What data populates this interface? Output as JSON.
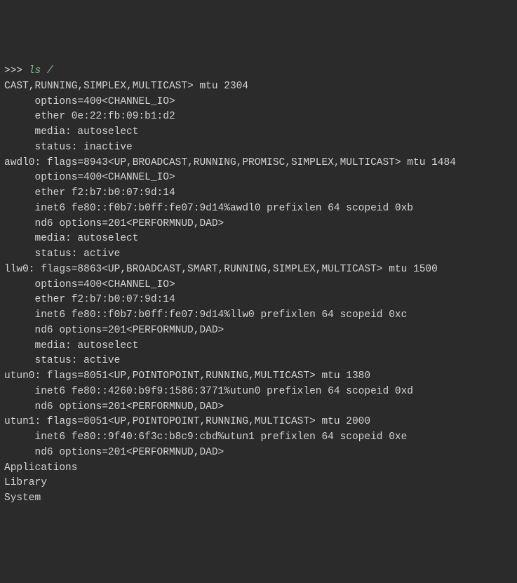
{
  "prompt": ">>> ",
  "command": "ls /",
  "lines": [
    "CAST,RUNNING,SIMPLEX,MULTICAST> mtu 2304",
    "     options=400<CHANNEL_IO>",
    "     ether 0e:22:fb:09:b1:d2",
    "     media: autoselect",
    "     status: inactive",
    "awdl0: flags=8943<UP,BROADCAST,RUNNING,PROMISC,SIMPLEX,MULTICAST> mtu 1484",
    "     options=400<CHANNEL_IO>",
    "     ether f2:b7:b0:07:9d:14",
    "     inet6 fe80::f0b7:b0ff:fe07:9d14%awdl0 prefixlen 64 scopeid 0xb",
    "     nd6 options=201<PERFORMNUD,DAD>",
    "     media: autoselect",
    "     status: active",
    "llw0: flags=8863<UP,BROADCAST,SMART,RUNNING,SIMPLEX,MULTICAST> mtu 1500",
    "     options=400<CHANNEL_IO>",
    "     ether f2:b7:b0:07:9d:14",
    "     inet6 fe80::f0b7:b0ff:fe07:9d14%llw0 prefixlen 64 scopeid 0xc",
    "     nd6 options=201<PERFORMNUD,DAD>",
    "     media: autoselect",
    "     status: active",
    "utun0: flags=8051<UP,POINTOPOINT,RUNNING,MULTICAST> mtu 1380",
    "     inet6 fe80::4260:b9f9:1586:3771%utun0 prefixlen 64 scopeid 0xd",
    "     nd6 options=201<PERFORMNUD,DAD>",
    "utun1: flags=8051<UP,POINTOPOINT,RUNNING,MULTICAST> mtu 2000",
    "     inet6 fe80::9f40:6f3c:b8c9:cbd%utun1 prefixlen 64 scopeid 0xe",
    "     nd6 options=201<PERFORMNUD,DAD>",
    "Applications",
    "Library",
    "System"
  ]
}
